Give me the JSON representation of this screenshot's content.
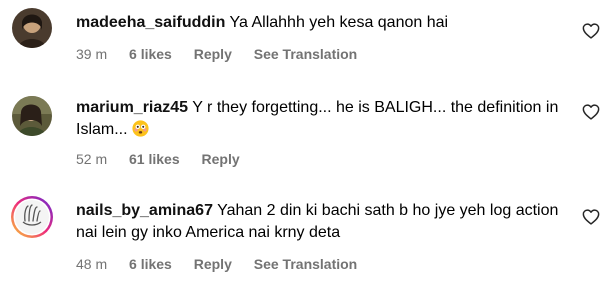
{
  "comments": [
    {
      "username": "madeeha_saifuddin",
      "text": "Ya Allahhh yeh kesa qanon hai",
      "time": "39 m",
      "likes": "6 likes",
      "reply": "Reply",
      "translate": "See Translation"
    },
    {
      "username": "marium_riaz45",
      "text": "Y r they forgetting... he is BALIGH... the definition in Islam...",
      "emoji": "flushed-face-emoji",
      "time": "52 m",
      "likes": "61 likes",
      "reply": "Reply"
    },
    {
      "username": "nails_by_amina67",
      "text": "Yahan 2 din ki bachi sath b ho jye yeh log action nai lein gy inko America nai krny deta",
      "time": "48 m",
      "likes": "6 likes",
      "reply": "Reply",
      "translate": "See Translation",
      "avatar_text": "Nails By Amina"
    }
  ],
  "icons": {
    "like": "heart-outline-icon"
  },
  "colors": {
    "meta": "#737373",
    "avatar_ring_start": "#f9ce34",
    "avatar_ring_mid": "#ee2a7b",
    "avatar_ring_end": "#6228d7"
  }
}
